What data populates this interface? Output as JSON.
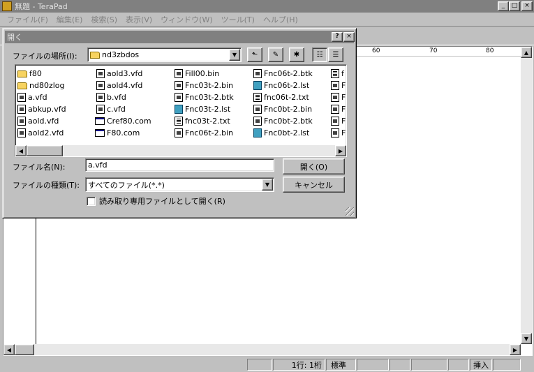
{
  "window": {
    "title": "無題 - TeraPad",
    "minimize": "_",
    "maximize": "□",
    "close": "×"
  },
  "menu": [
    "ファイル(F)",
    "編集(E)",
    "検索(S)",
    "表示(V)",
    "ウィンドウ(W)",
    "ツール(T)",
    "ヘルプ(H)"
  ],
  "ruler": {
    "marks": [
      "60",
      "70",
      "80"
    ]
  },
  "statusbar": {
    "position": "1行:   1桁",
    "mode": "標準",
    "insert": "挿入"
  },
  "dialog": {
    "title": "開く",
    "help": "?",
    "close": "×",
    "location_label": "ファイルの場所(I):",
    "location_value": "nd3zbdos",
    "filename_label": "ファイル名(N):",
    "filename_value": "a.vfd",
    "filetype_label": "ファイルの種類(T):",
    "filetype_value": "すべてのファイル(*.*)",
    "open_button": "開く(O)",
    "cancel_button": "キャンセル",
    "readonly_label": "読み取り専用ファイルとして開く(R)",
    "files": [
      [
        {
          "name": "f80",
          "icon": "folder"
        },
        {
          "name": "nd80zlog",
          "icon": "folder"
        },
        {
          "name": "a.vfd",
          "icon": "doc"
        },
        {
          "name": "abkup.vfd",
          "icon": "doc"
        },
        {
          "name": "aold.vfd",
          "icon": "doc"
        },
        {
          "name": "aold2.vfd",
          "icon": "doc"
        }
      ],
      [
        {
          "name": "aold3.vfd",
          "icon": "doc"
        },
        {
          "name": "aold4.vfd",
          "icon": "doc"
        },
        {
          "name": "b.vfd",
          "icon": "doc"
        },
        {
          "name": "c.vfd",
          "icon": "doc"
        },
        {
          "name": "Cref80.com",
          "icon": "exe"
        },
        {
          "name": "F80.com",
          "icon": "exe"
        }
      ],
      [
        {
          "name": "Fill00.bin",
          "icon": "bin"
        },
        {
          "name": "Fnc03t-2.bin",
          "icon": "bin"
        },
        {
          "name": "Fnc03t-2.btk",
          "icon": "bin"
        },
        {
          "name": "Fnc03t-2.lst",
          "icon": "lst"
        },
        {
          "name": "fnc03t-2.txt",
          "icon": "txt"
        },
        {
          "name": "Fnc06t-2.bin",
          "icon": "bin"
        }
      ],
      [
        {
          "name": "Fnc06t-2.btk",
          "icon": "bin"
        },
        {
          "name": "Fnc06t-2.lst",
          "icon": "lst"
        },
        {
          "name": "fnc06t-2.txt",
          "icon": "txt"
        },
        {
          "name": "Fnc0bt-2.bin",
          "icon": "bin"
        },
        {
          "name": "Fnc0bt-2.btk",
          "icon": "bin"
        },
        {
          "name": "Fnc0bt-2.lst",
          "icon": "lst"
        }
      ],
      [
        {
          "name": "f",
          "icon": "txt"
        },
        {
          "name": "F",
          "icon": "doc"
        },
        {
          "name": "F",
          "icon": "doc"
        },
        {
          "name": "F",
          "icon": "doc"
        },
        {
          "name": "F",
          "icon": "doc"
        },
        {
          "name": "F",
          "icon": "doc"
        }
      ]
    ]
  }
}
